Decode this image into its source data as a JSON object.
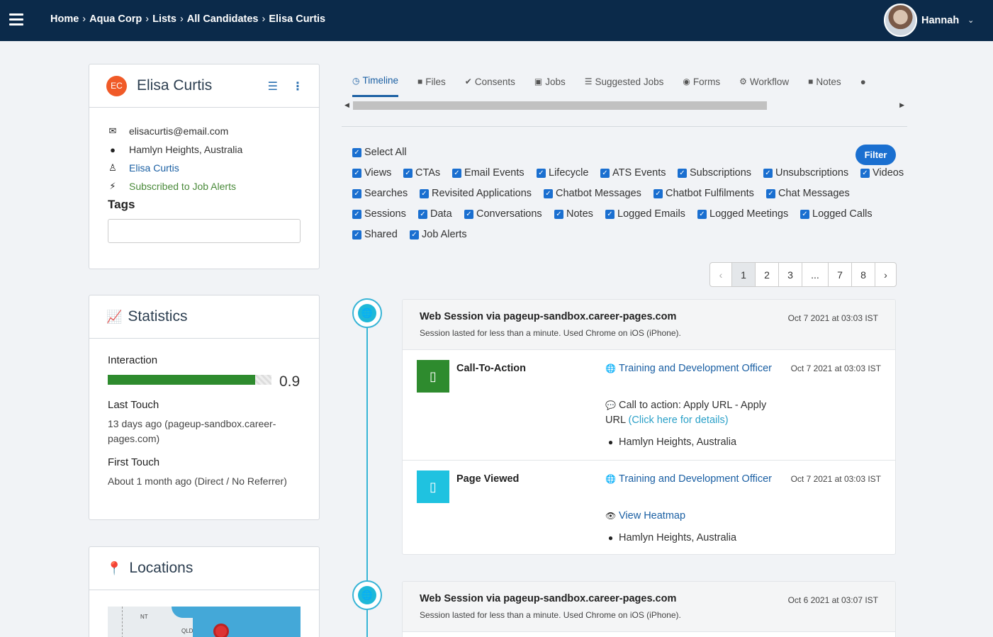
{
  "breadcrumb": [
    "Home",
    "Aqua Corp",
    "Lists",
    "All Candidates",
    "Elisa Curtis"
  ],
  "user": {
    "name": "Hannah"
  },
  "profile": {
    "initials": "EC",
    "name": "Elisa Curtis",
    "email": "elisacurtis@email.com",
    "location": "Hamlyn Heights, Australia",
    "owner": "Elisa Curtis",
    "subscription": "Subscribed to Job Alerts",
    "tags_label": "Tags"
  },
  "statistics": {
    "title": "Statistics",
    "interaction_label": "Interaction",
    "interaction_value": "0.9",
    "interaction_fraction": 0.9,
    "last_touch_label": "Last Touch",
    "last_touch_value": "13 days ago (pageup-sandbox.career-pages.com)",
    "first_touch_label": "First Touch",
    "first_touch_value": "About 1 month ago (Direct / No Referrer)"
  },
  "locations": {
    "title": "Locations",
    "map_labels": [
      "NT",
      "QLD"
    ]
  },
  "tabs": [
    {
      "label": "Timeline",
      "icon": "clock-icon"
    },
    {
      "label": "Files",
      "icon": "file-icon"
    },
    {
      "label": "Consents",
      "icon": "check-circle-icon"
    },
    {
      "label": "Jobs",
      "icon": "briefcase-icon"
    },
    {
      "label": "Suggested Jobs",
      "icon": "list-icon"
    },
    {
      "label": "Forms",
      "icon": "circle-icon"
    },
    {
      "label": "Workflow",
      "icon": "cogs-icon"
    },
    {
      "label": "Notes",
      "icon": "note-icon"
    }
  ],
  "filters": {
    "button": "Filter",
    "select_all": "Select All",
    "rows": [
      [
        "Views",
        "CTAs",
        "Email Events",
        "Lifecycle",
        "ATS Events",
        "Subscriptions",
        "Unsubscriptions",
        "Videos"
      ],
      [
        "Searches",
        "Revisited Applications",
        "Chatbot Messages",
        "Chatbot Fulfilments",
        "Chat Messages"
      ],
      [
        "Sessions",
        "Data",
        "Conversations",
        "Notes",
        "Logged Emails",
        "Logged Meetings",
        "Logged Calls"
      ],
      [
        "Shared",
        "Job Alerts"
      ]
    ]
  },
  "pagination": {
    "prev": "‹",
    "pages": [
      "1",
      "2",
      "3",
      "...",
      "7",
      "8"
    ],
    "next": "›",
    "current": "1"
  },
  "sessions": [
    {
      "title": "Web Session via pageup-sandbox.career-pages.com",
      "subtitle": "Session lasted for less than a minute. Used Chrome on iOS (iPhone).",
      "date": "Oct 7 2021 at 03:03 IST",
      "events": [
        {
          "title": "Call-To-Action",
          "job": "Training and Development Officer",
          "detail": "Call to action: Apply URL - Apply URL",
          "detail_link": "(Click here for details)",
          "location": "Hamlyn Heights, Australia",
          "date": "Oct 7 2021 at 03:03 IST",
          "color": "#2e8b2e"
        },
        {
          "title": "Page Viewed",
          "job": "Training and Development Officer",
          "heatmap": "View Heatmap",
          "location": "Hamlyn Heights, Australia",
          "date": "Oct 7 2021 at 03:03 IST",
          "color": "#1fc2e0"
        }
      ]
    },
    {
      "title": "Web Session via pageup-sandbox.career-pages.com",
      "subtitle": "Session lasted for less than a minute. Used Chrome on iOS (iPhone).",
      "date": "Oct 6 2021 at 03:07 IST"
    }
  ]
}
